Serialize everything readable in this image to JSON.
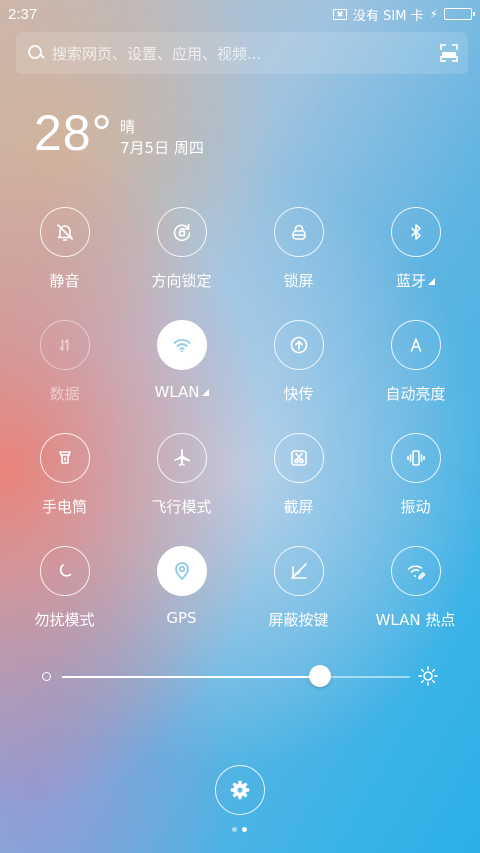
{
  "status_bar": {
    "time": "2:37",
    "carrier": "没有 SIM 卡",
    "battery_level": 0.85
  },
  "search": {
    "placeholder": "搜索网页、设置、应用、视频..."
  },
  "weather": {
    "temperature": "28°",
    "condition": "晴",
    "date": "7月5日 周四"
  },
  "toggles": [
    {
      "label": "静音",
      "icon": "bell-off-icon",
      "state": "off"
    },
    {
      "label": "方向锁定",
      "icon": "rotation-lock-icon",
      "state": "off"
    },
    {
      "label": "锁屏",
      "icon": "lock-icon",
      "state": "off"
    },
    {
      "label": "蓝牙",
      "icon": "bluetooth-icon",
      "state": "off",
      "has_more": true
    },
    {
      "label": "数据",
      "icon": "mobile-data-icon",
      "state": "disabled"
    },
    {
      "label": "WLAN",
      "icon": "wifi-icon",
      "state": "on",
      "has_more": true
    },
    {
      "label": "快传",
      "icon": "quick-transfer-icon",
      "state": "off"
    },
    {
      "label": "自动亮度",
      "icon": "auto-brightness-icon",
      "state": "off"
    },
    {
      "label": "手电筒",
      "icon": "flashlight-icon",
      "state": "off"
    },
    {
      "label": "飞行模式",
      "icon": "airplane-icon",
      "state": "off"
    },
    {
      "label": "截屏",
      "icon": "screenshot-icon",
      "state": "off"
    },
    {
      "label": "振动",
      "icon": "vibrate-icon",
      "state": "off"
    },
    {
      "label": "勿扰模式",
      "icon": "moon-icon",
      "state": "off"
    },
    {
      "label": "GPS",
      "icon": "gps-icon",
      "state": "on"
    },
    {
      "label": "屏蔽按键",
      "icon": "block-keys-icon",
      "state": "off"
    },
    {
      "label": "WLAN 热点",
      "icon": "hotspot-icon",
      "state": "off"
    }
  ],
  "brightness": {
    "level": 0.74
  },
  "pager": {
    "pages": 2,
    "current": 2
  }
}
